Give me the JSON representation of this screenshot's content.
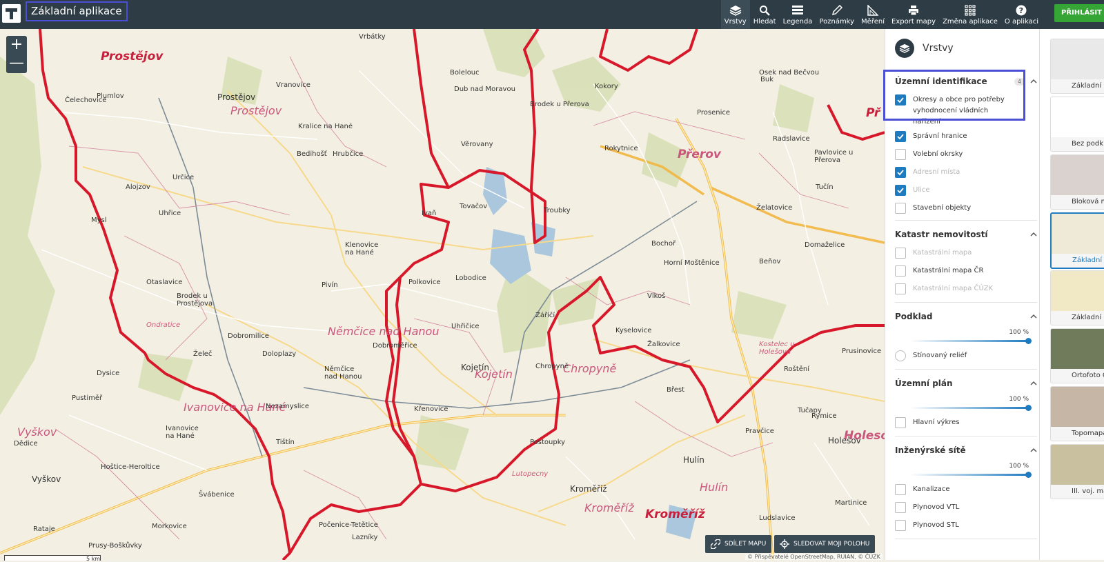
{
  "app": {
    "title": "Základní aplikace"
  },
  "toolbar": [
    {
      "label": "Vrstvy",
      "icon": "layers-icon"
    },
    {
      "label": "Hledat",
      "icon": "search-icon"
    },
    {
      "label": "Legenda",
      "icon": "legend-icon"
    },
    {
      "label": "Poznámky",
      "icon": "pencil-icon"
    },
    {
      "label": "Měření",
      "icon": "ruler-icon"
    },
    {
      "label": "Export mapy",
      "icon": "print-icon"
    },
    {
      "label": "Změna aplikace",
      "icon": "grid-icon"
    },
    {
      "label": "O aplikaci",
      "icon": "help-icon"
    }
  ],
  "login": {
    "label": "PŘIHLÁSIT S"
  },
  "map": {
    "big_labels": [
      "Prostějov",
      "Přerov",
      "Kroměříž",
      "Holeso",
      "Př"
    ],
    "districts": [
      "Prostějov",
      "Přerov",
      "Němčice nad Hanou",
      "Kojetín",
      "Chropyně",
      "Ivanovice na Hané",
      "Vyškov",
      "Kroměříž",
      "Hulín"
    ],
    "towns": [
      "Prostějov",
      "Vrbátky",
      "Vranovice",
      "Kralice na Hané",
      "Bedihošť",
      "Hrubčice",
      "Bolelouc",
      "Dub nad Moravou",
      "Brodek u Přerova",
      "Kokory",
      "Prosenice",
      "Bochoř",
      "Věrovany",
      "Tovačov",
      "Troubky",
      "Ivaň",
      "Klenovice na Hané",
      "Polkovice",
      "Lobodice",
      "Uhřičice",
      "Kojetín",
      "Chropyně",
      "Kyselovice",
      "Žalkovice",
      "Kostelec u Holešova",
      "Němčice nad Hanou",
      "Dobromilice",
      "Doloplazy",
      "Želeč",
      "Pivín",
      "Otaslavice",
      "Brodek u Prostějova",
      "Nezamyslice",
      "Křenovice",
      "Tištín",
      "Ivanovice na Hané",
      "Dědice",
      "Vyškov",
      "Hoštice-Heroltice",
      "Švábenice",
      "Morkovice",
      "Uhřice",
      "Mysl",
      "Alojzov",
      "Určice",
      "Plumlov",
      "Hulín",
      "Kroměříž",
      "Postoupky",
      "Břest",
      "Pravčice",
      "Rymice",
      "Holešov",
      "Vlkoš",
      "Horní Moštěnice",
      "Beňov",
      "Domaželice",
      "Tučín",
      "Želatovice",
      "Radslavice",
      "Pavlovice u Přerova",
      "Osek nad Bečvou",
      "Buk",
      "Rokytnice",
      "Prusinovice",
      "Rataje",
      "Počenice-Tetětice",
      "Dysice",
      "Pustiměř",
      "Zářičí",
      "Tučapy",
      "Roštění",
      "Lutopecny",
      "Ludslavice",
      "Martinice",
      "Prusy-Boškůvky",
      "Dobroměřice",
      "Lazníky",
      "Čelechovice",
      "Ondratice"
    ],
    "zoom_in": "+",
    "zoom_out": "—",
    "share_label": "SDÍLET MAPU",
    "track_label": "SLEDOVAT MOJI POLOHU",
    "attribution": "© Přispěvatelé OpenStreetMap, RUIAN, © ČÚZK",
    "scale": "5 km"
  },
  "panel": {
    "title": "Vrstvy",
    "groups": [
      {
        "title": "Územní identifikace",
        "badge": "4",
        "items": [
          {
            "label": "Okresy a obce pro potřeby vyhodnocení vládních nařízení",
            "checked": true,
            "disabled": false
          },
          {
            "label": "Správní hranice",
            "checked": true,
            "disabled": false
          },
          {
            "label": "Volební okrsky",
            "checked": false,
            "disabled": false
          },
          {
            "label": "Adresní místa",
            "checked": true,
            "disabled": true
          },
          {
            "label": "Ulice",
            "checked": true,
            "disabled": true
          },
          {
            "label": "Stavební objekty",
            "checked": false,
            "disabled": false
          }
        ]
      },
      {
        "title": "Katastr nemovitostí",
        "items": [
          {
            "label": "Katastrální mapa",
            "checked": false,
            "disabled": true
          },
          {
            "label": "Katastrální mapa ČR",
            "checked": false,
            "disabled": false
          },
          {
            "label": "Katastrální mapa ČÚZK",
            "checked": false,
            "disabled": true
          }
        ]
      },
      {
        "title": "Podklad",
        "opacity": "100 %",
        "opacity_value": 100,
        "items": [
          {
            "label": "Stínovaný reliéf",
            "checked": false,
            "disabled": false,
            "radio": true
          }
        ]
      },
      {
        "title": "Územní plán",
        "opacity": "100 %",
        "opacity_value": 100,
        "items": [
          {
            "label": "Hlavní výkres",
            "checked": false,
            "disabled": false
          }
        ]
      },
      {
        "title": "Inženýrské sítě",
        "opacity": "100 %",
        "opacity_value": 100,
        "items": [
          {
            "label": "Kanalizace",
            "checked": false,
            "disabled": false
          },
          {
            "label": "Plynovod VTL",
            "checked": false,
            "disabled": false
          },
          {
            "label": "Plynovod STL",
            "checked": false,
            "disabled": false
          }
        ]
      }
    ]
  },
  "basemaps": [
    {
      "label": "Základní m",
      "selected": false,
      "color": "#e9e9e9"
    },
    {
      "label": "Bez podk",
      "selected": false,
      "color": "#ffffff"
    },
    {
      "label": "Bloková mapa",
      "selected": false,
      "color": "#d9d2ce"
    },
    {
      "label": "Základní m",
      "selected": true,
      "color": "#efe9d8"
    },
    {
      "label": "Základní map",
      "selected": false,
      "color": "#f1e8c6"
    },
    {
      "label": "Ortofoto Č",
      "selected": false,
      "color": "#6f7b5a"
    },
    {
      "label": "Topomapa",
      "selected": false,
      "color": "#c6b6a6"
    },
    {
      "label": "III. voj. map",
      "selected": false,
      "color": "#c9c0a0"
    }
  ]
}
